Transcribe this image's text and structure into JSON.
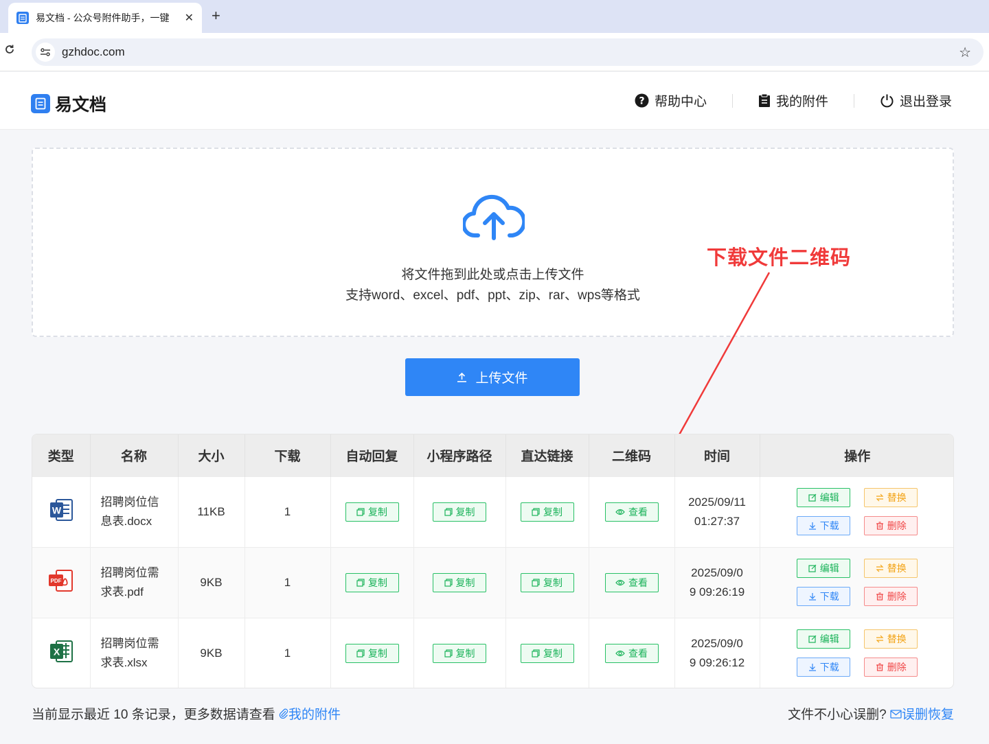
{
  "browser": {
    "tab_title": "易文档 - 公众号附件助手，一键",
    "url": "gzhdoc.com"
  },
  "header": {
    "brand": "易文档",
    "nav": [
      {
        "label": "帮助中心",
        "icon": "help-circle-icon"
      },
      {
        "label": "我的附件",
        "icon": "clipboard-icon"
      },
      {
        "label": "退出登录",
        "icon": "power-icon"
      }
    ]
  },
  "upload": {
    "hint_line1": "将文件拖到此处或点击上传文件",
    "hint_line2": "支持word、excel、pdf、ppt、zip、rar、wps等格式",
    "button_label": "上传文件"
  },
  "annotation": {
    "text": "下载文件二维码"
  },
  "table": {
    "headers": [
      "类型",
      "名称",
      "大小",
      "下载",
      "自动回复",
      "小程序路径",
      "直达链接",
      "二维码",
      "时间",
      "操作"
    ],
    "copy_label": "复制",
    "view_label": "查看",
    "edit_label": "编辑",
    "replace_label": "替换",
    "download_label": "下载",
    "delete_label": "删除",
    "rows": [
      {
        "type": "word",
        "name_line1": "招聘岗位信",
        "name_line2": "息表.docx",
        "size": "11KB",
        "downloads": "1",
        "time_line1": "2025/09/11",
        "time_line2": "01:27:37"
      },
      {
        "type": "pdf",
        "name_line1": "招聘岗位需",
        "name_line2": "求表.pdf",
        "size": "9KB",
        "downloads": "1",
        "time_line1": "2025/09/0",
        "time_line2": "9 09:26:19"
      },
      {
        "type": "excel",
        "name_line1": "招聘岗位需",
        "name_line2": "求表.xlsx",
        "size": "9KB",
        "downloads": "1",
        "time_line1": "2025/09/0",
        "time_line2": "9 09:26:12"
      }
    ]
  },
  "footer": {
    "left_text": "当前显示最近 10 条记录，更多数据请查看",
    "left_link": "我的附件",
    "right_text": "文件不小心误删?",
    "right_link": "误删恢复"
  },
  "colors": {
    "accent": "#2f86f6",
    "green": "#1bb35a",
    "orange": "#f3a418",
    "red": "#f04747",
    "annotation": "#f03a3a"
  }
}
